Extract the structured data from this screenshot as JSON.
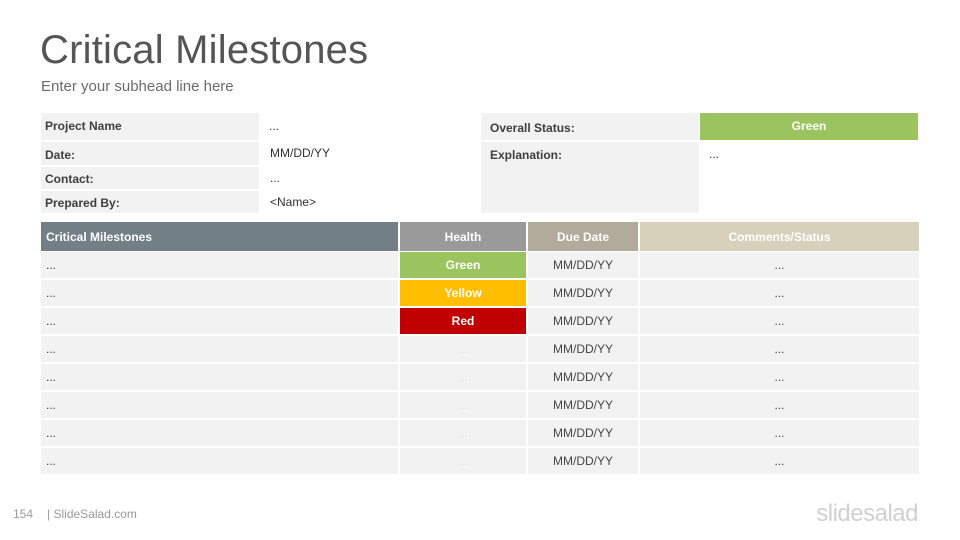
{
  "slide": {
    "title": "Critical Milestones",
    "subhead": "Enter your subhead line here"
  },
  "info": {
    "project_name_label": "Project Name",
    "project_name_value": "...",
    "date_label": "Date:",
    "date_value": "MM/DD/YY",
    "contact_label": "Contact:",
    "contact_value": "...",
    "prepared_by_label": "Prepared By:",
    "prepared_by_value": "<Name>",
    "overall_status_label": "Overall Status:",
    "overall_status_value": "Green",
    "explanation_label": "Explanation:",
    "explanation_value": "..."
  },
  "table": {
    "headers": [
      "Critical Milestones",
      "Health",
      "Due Date",
      "Comments/Status"
    ],
    "rows": [
      {
        "milestone": "...",
        "health": "Green",
        "due": "MM/DD/YY",
        "comments": "..."
      },
      {
        "milestone": "...",
        "health": "Yellow",
        "due": "MM/DD/YY",
        "comments": "..."
      },
      {
        "milestone": "...",
        "health": "Red",
        "due": "MM/DD/YY",
        "comments": "..."
      },
      {
        "milestone": "...",
        "health": "...",
        "due": "MM/DD/YY",
        "comments": "..."
      },
      {
        "milestone": "...",
        "health": "...",
        "due": "MM/DD/YY",
        "comments": "..."
      },
      {
        "milestone": "...",
        "health": "...",
        "due": "MM/DD/YY",
        "comments": "..."
      },
      {
        "milestone": "...",
        "health": "...",
        "due": "MM/DD/YY",
        "comments": "..."
      },
      {
        "milestone": "...",
        "health": "...",
        "due": "MM/DD/YY",
        "comments": "..."
      }
    ]
  },
  "colors": {
    "green": "#9bc45f",
    "yellow": "#ffbf00",
    "red": "#c00000",
    "header_milestones": "#737f86",
    "header_health": "#9a9a9a",
    "header_due": "#b1ab9c",
    "header_comments": "#d7d0bb"
  },
  "footer": {
    "page_number": "154",
    "site": "| SlideSalad.com",
    "brand": "slidesalad"
  }
}
